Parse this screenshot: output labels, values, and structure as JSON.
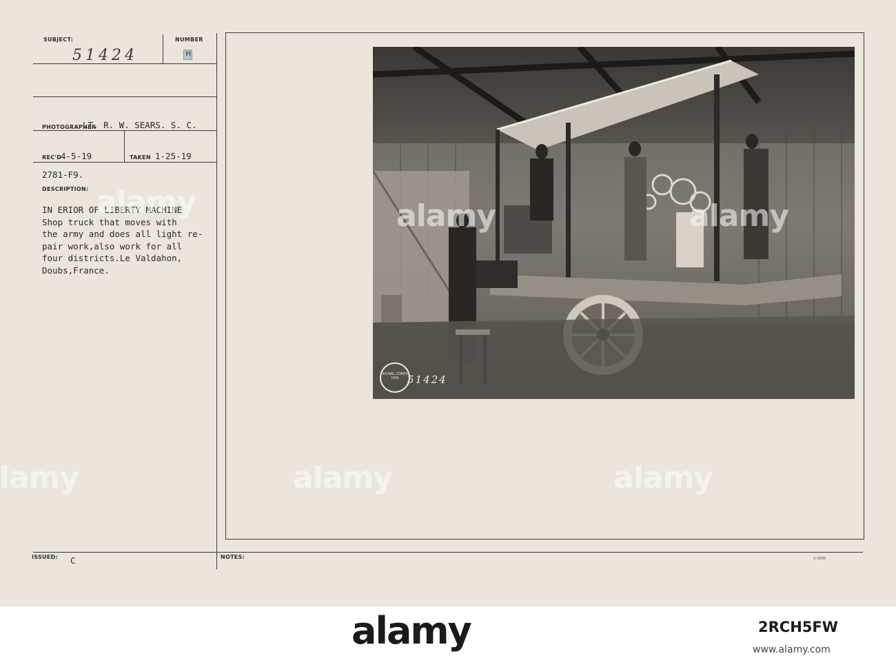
{
  "form": {
    "subject_label": "SUBJECT:",
    "subject_number": "51424",
    "number_label": "NUMBER",
    "number_stamp": "H",
    "photographer_label": "PHOTOGRAPHER",
    "photographer_value": "LT. R. W. SEARS. S. C.",
    "recd_label": "REC'D",
    "recd_value": "4-5-19",
    "taken_label": "TAKEN",
    "taken_value": "1-25-19",
    "file_code": "2781-F9.",
    "description_label": "DESCRIPTION:",
    "description_lines": [
      "IN ERIOR OF LIBERTY MACHINE",
      "Shop truck that moves with",
      "the army and does all light re-",
      "pair work,also work for all",
      "four districts.Le Valdahon,",
      "Doubs,France."
    ],
    "issued_label": "ISSUED:",
    "issued_value": "C",
    "notes_label": "NOTES:",
    "form_ref": "3—5605"
  },
  "photo": {
    "stamp_text": "SIGNAL CORPS USA",
    "stamp_number": "51424"
  },
  "watermark": {
    "text": "alamy"
  },
  "footer": {
    "logo_text": "alamy",
    "stock_id": "2RCH5FW",
    "site": "www.alamy.com"
  }
}
